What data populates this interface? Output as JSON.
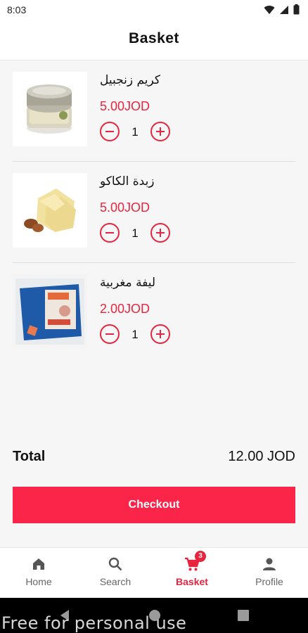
{
  "status_bar": {
    "time": "8:03"
  },
  "header": {
    "title": "Basket"
  },
  "items": [
    {
      "name": "كريم زنجبيل",
      "price": "5.00JOD",
      "quantity": "1",
      "image": "jar-image"
    },
    {
      "name": "زبدة الكاكو",
      "price": "5.00JOD",
      "quantity": "1",
      "image": "cocoa-butter-image"
    },
    {
      "name": "ليفة مغربية",
      "price": "2.00JOD",
      "quantity": "1",
      "image": "loofah-image"
    }
  ],
  "summary": {
    "total_label": "Total",
    "total_value": "12.00 JOD"
  },
  "checkout": {
    "label": "Checkout"
  },
  "nav": {
    "items": [
      {
        "label": "Home",
        "icon": "home-icon"
      },
      {
        "label": "Search",
        "icon": "search-icon"
      },
      {
        "label": "Basket",
        "icon": "cart-icon",
        "badge": "3",
        "active": true
      },
      {
        "label": "Profile",
        "icon": "person-icon"
      }
    ]
  },
  "watermark": "Free for personal use",
  "colors": {
    "accent": "#e8253f",
    "button": "#fb2449",
    "background": "#f6f6f6"
  }
}
